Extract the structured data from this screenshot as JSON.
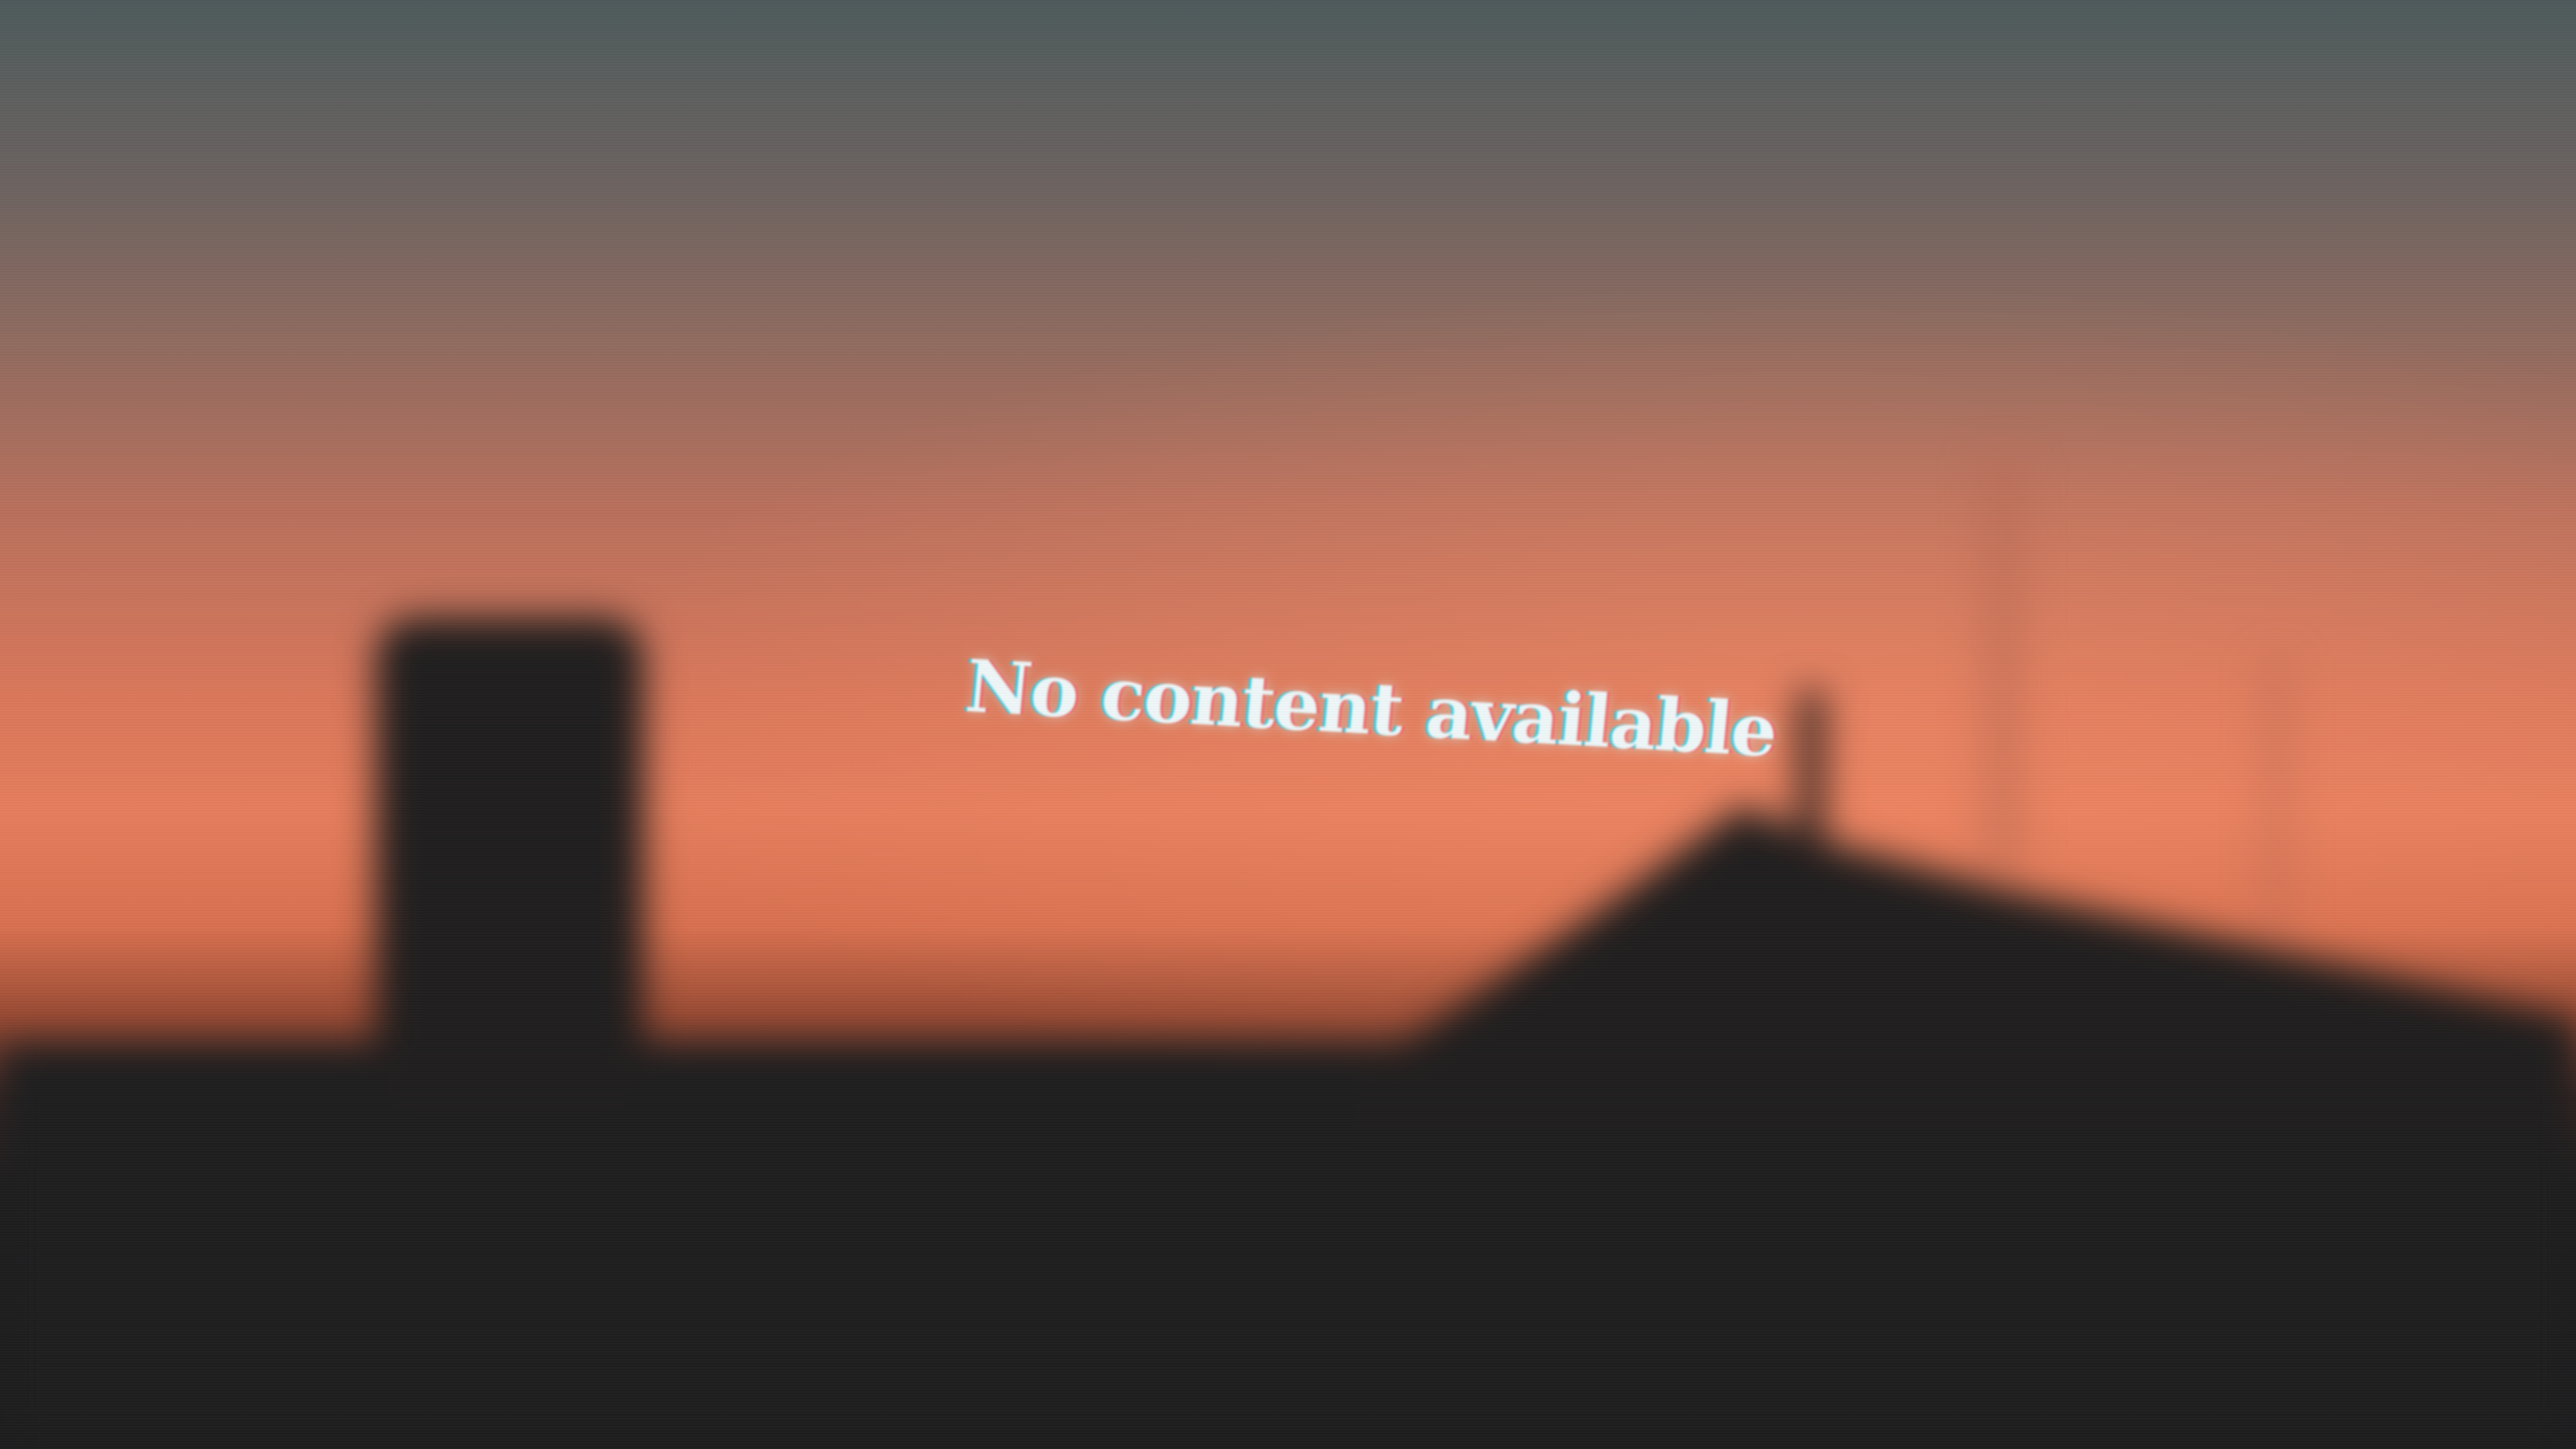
{
  "message": {
    "text": "No content available"
  },
  "colors": {
    "sky_top": "#4d5a5b",
    "sky_mid": "#b8705c",
    "horizon_glow": "#e57d5c",
    "silhouette": "#1e1e1f",
    "text": "#eef6f7"
  }
}
